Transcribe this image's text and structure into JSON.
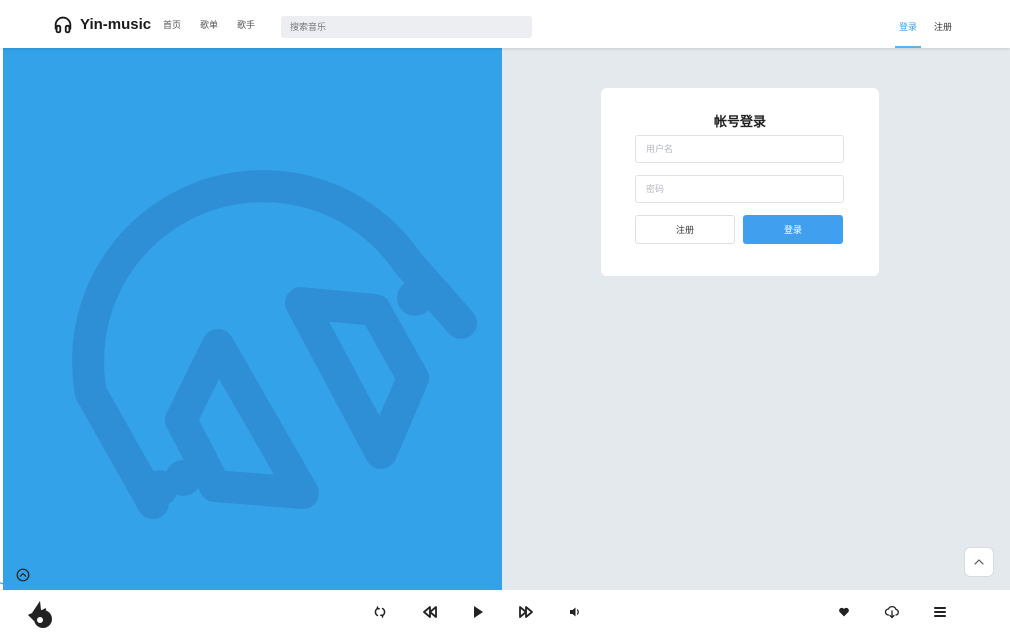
{
  "header": {
    "logo_text": "Yin-music",
    "nav": [
      "首页",
      "歌单",
      "歌手"
    ],
    "search_placeholder": "搜索音乐",
    "login_label": "登录",
    "register_label": "注册"
  },
  "login_card": {
    "title": "帐号登录",
    "username_placeholder": "用户名",
    "password_placeholder": "密码",
    "register_button": "注册",
    "login_button": "登录"
  },
  "colors": {
    "accent": "#419ff0",
    "illustration_bg": "#34a2e8",
    "illustration_fg": "#2f8fd6",
    "page_bg": "#e4e9ee"
  },
  "icons": {
    "logo": "headphones-icon",
    "back_to_top": "chevron-up-icon",
    "expand": "chevron-up-circle-icon",
    "player": [
      "loop-icon",
      "previous-icon",
      "play-icon",
      "next-icon",
      "volume-icon",
      "heart-icon",
      "download-icon",
      "playlist-icon"
    ]
  }
}
